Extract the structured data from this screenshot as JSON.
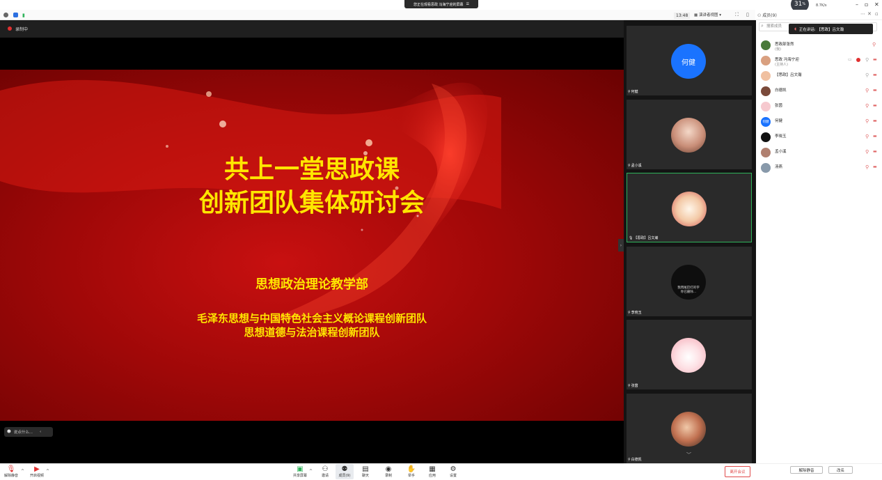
{
  "banner": {
    "text": "您正在观看思政 冯海宁迎的屏幕",
    "menu_icon": "menu-icon"
  },
  "speed": {
    "percent": "31",
    "unit": "%",
    "rate": "8.7",
    "rate_unit": "K/s"
  },
  "window": {
    "minimize": "–",
    "restore": "▫",
    "close": "✕"
  },
  "toolbar": {
    "time": "13:48",
    "view_label": "演讲者视图",
    "members_label": "成员(9)"
  },
  "recording": {
    "label": "录制中"
  },
  "slide": {
    "title_line1": "共上一堂思政课",
    "title_line2": "创新团队集体研讨会",
    "dept": "思想政治理论教学部",
    "team_line1": "毛泽东思想与中国特色社会主义概论课程创新团队",
    "team_line2": "思想道德与法治课程创新团队"
  },
  "chat_input": {
    "placeholder": "说点什么..."
  },
  "tiles": [
    {
      "name": "何健",
      "avatar_text": "何健",
      "color": "#1a73ff"
    },
    {
      "name": "孟小溪",
      "avatar_text": "",
      "color": "#e9b9a8"
    },
    {
      "name": "【思政】吕文瀚",
      "avatar_text": "",
      "color": "#f0d9c8"
    },
    {
      "name": "李晓玉",
      "avatar_text": "我用尾巴打的字",
      "avatar_text2": "你已删除...",
      "color": "#111111"
    },
    {
      "name": "张茵",
      "avatar_text": "",
      "color": "#f6c9cf"
    },
    {
      "name": "白德凯",
      "avatar_text": "",
      "color": "#d88a6a"
    }
  ],
  "members_panel": {
    "search_placeholder": "搜索成员",
    "speaking": "正在讲话: 【思政】吕文瀚",
    "list": [
      {
        "name": "思政部张然",
        "sub": "(我)",
        "color": "#4a7a3a"
      },
      {
        "name": "思政 冯海宁迎",
        "sub": "(主持人)",
        "color": "#d9a080"
      },
      {
        "name": "【思政】吕文瀚",
        "sub": "",
        "color": "#f0c0a0"
      },
      {
        "name": "白德凯",
        "sub": "",
        "color": "#7a4a3a"
      },
      {
        "name": "张茵",
        "sub": "",
        "color": "#f6c9cf"
      },
      {
        "name": "何健",
        "sub": "",
        "color": "#1a73ff",
        "avatar_text": "何健"
      },
      {
        "name": "李晓玉",
        "sub": "",
        "color": "#111111"
      },
      {
        "name": "孟小溪",
        "sub": "",
        "color": "#b08070"
      },
      {
        "name": "汤燕",
        "sub": "",
        "color": "#8899aa"
      }
    ],
    "mute_all": "解除静音",
    "rename": "改名"
  },
  "bottom": {
    "unmute": "解除静音",
    "video": "开启视频",
    "share": "共享屏幕",
    "invite": "邀请",
    "members": "成员(9)",
    "chat": "聊天",
    "record": "录制",
    "raise": "举手",
    "apps": "应用",
    "settings": "设置",
    "leave": "离开会议"
  }
}
